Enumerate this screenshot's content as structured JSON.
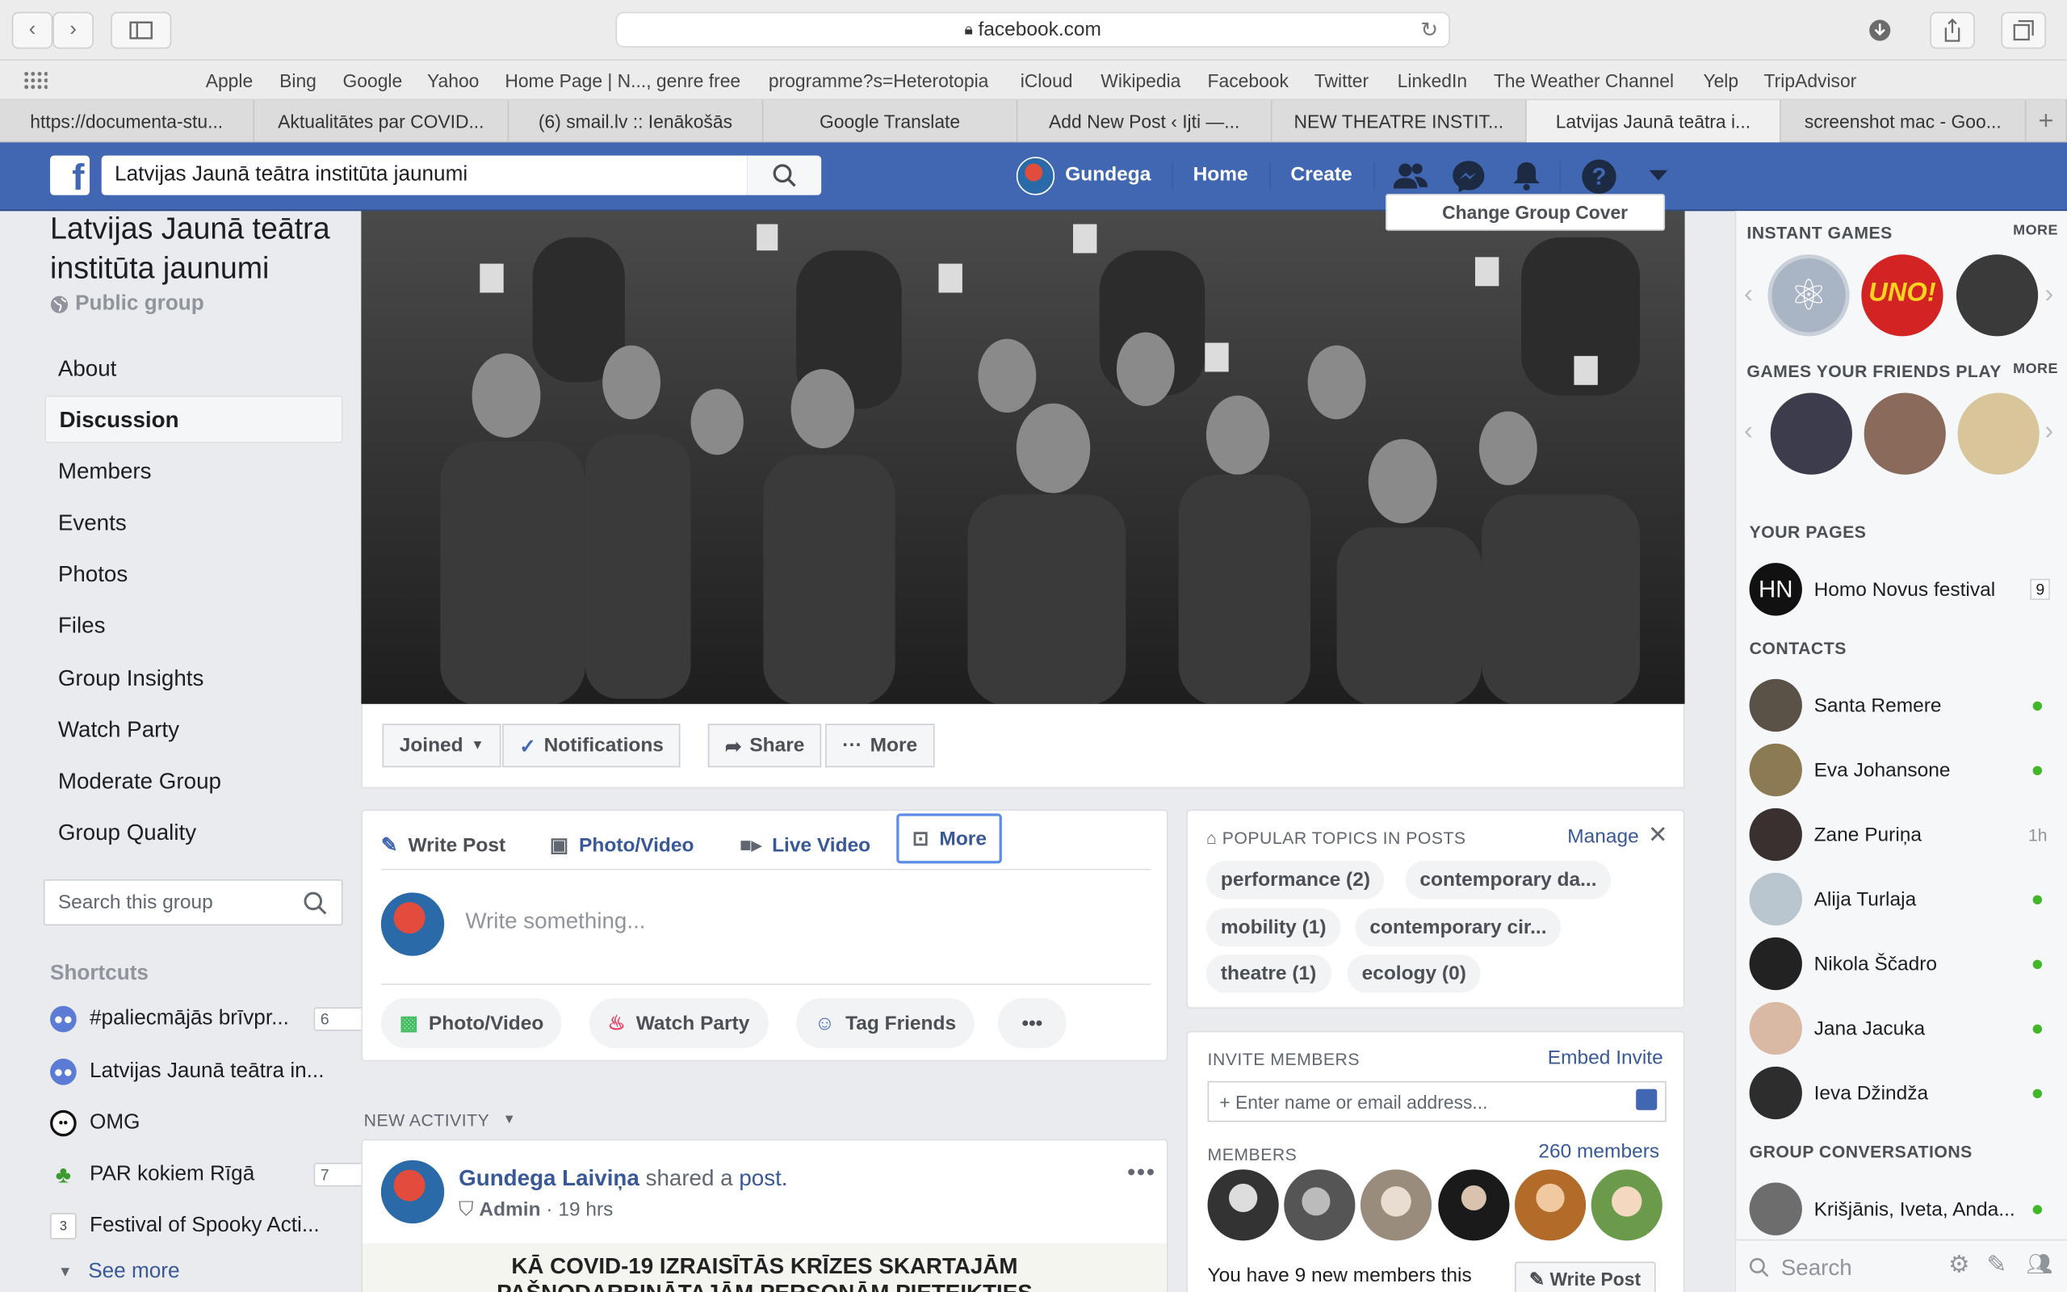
{
  "browser": {
    "url": "facebook.com",
    "favorites": [
      "Apple",
      "Bing",
      "Google",
      "Yahoo",
      "Home Page | N..., genre free",
      "programme?s=Heterotopia",
      "iCloud",
      "Wikipedia",
      "Facebook",
      "Twitter",
      "LinkedIn",
      "The Weather Channel",
      "Yelp",
      "TripAdvisor"
    ],
    "tabs": [
      "https://documenta-stu...",
      "Aktualitātes par COVID...",
      "(6) smail.lv :: Ienākošās",
      "Google Translate",
      "Add New Post ‹ Ijti —...",
      "NEW THEATRE INSTIT...",
      "Latvijas Jaunā teātra i...",
      "screenshot mac - Goo..."
    ]
  },
  "header": {
    "search_value": "Latvijas Jaunā teātra institūta jaunumi",
    "user": "Gundega",
    "home": "Home",
    "create": "Create"
  },
  "group": {
    "name": "Latvijas Jaunā teātra institūta jaunumi",
    "privacy": "Public group",
    "nav": [
      "About",
      "Discussion",
      "Members",
      "Events",
      "Photos",
      "Files",
      "Group Insights",
      "Watch Party",
      "Moderate Group",
      "Group Quality"
    ],
    "search_placeholder": "Search this group",
    "shortcuts_title": "Shortcuts",
    "shortcuts": [
      {
        "label": "#paliecmājās brīvpr...",
        "badge": "6"
      },
      {
        "label": "Latvijas Jaunā teātra in...",
        "badge": ""
      },
      {
        "label": "OMG",
        "badge": ""
      },
      {
        "label": "PAR kokiem Rīgā",
        "badge": "7"
      },
      {
        "label": "Festival of Spooky Acti...",
        "badge": ""
      }
    ],
    "see_more": "See more",
    "change_cover": "Change Group Cover"
  },
  "actions": {
    "joined": "Joined",
    "notifications": "Notifications",
    "share": "Share",
    "more": "More"
  },
  "composer": {
    "tabs": [
      "Write Post",
      "Photo/Video",
      "Live Video",
      "More"
    ],
    "placeholder": "Write something...",
    "pills": [
      "Photo/Video",
      "Watch Party",
      "Tag Friends"
    ]
  },
  "topics": {
    "title": "POPULAR TOPICS IN POSTS",
    "manage": "Manage",
    "items": [
      "performance (2)",
      "contemporary da...",
      "mobility (1)",
      "contemporary cir...",
      "theatre (1)",
      "ecology (0)"
    ]
  },
  "invite": {
    "title": "INVITE MEMBERS",
    "embed": "Embed Invite",
    "placeholder": "+ Enter name or email address...",
    "members_title": "MEMBERS",
    "members_count": "260 members",
    "new_members": "You have 9 new members this",
    "write_post": "Write Post"
  },
  "activity": {
    "title": "NEW ACTIVITY",
    "author": "Gundega Laiviņa",
    "shared": "shared a",
    "post": "post.",
    "role": "Admin",
    "time": "· 19 hrs",
    "preview_line1": "KĀ COVID-19 IZRAISĪTĀS KRĪZES SKARTAJĀM",
    "preview_line2": "PAŠNODARBINĀTAJĀM PERSONĀM PIETEIKTIES"
  },
  "sidebar": {
    "instant_games": "INSTANT GAMES",
    "more": "MORE",
    "friends_games": "GAMES YOUR FRIENDS PLAY",
    "your_pages": "YOUR PAGES",
    "page_name": "Homo Novus festival",
    "page_badge": "9",
    "contacts_title": "CONTACTS",
    "contacts": [
      {
        "name": "Santa Remere",
        "status": ""
      },
      {
        "name": "Eva Johansone",
        "status": ""
      },
      {
        "name": "Zane Puriņa",
        "status": "1h"
      },
      {
        "name": "Alija Turlaja",
        "status": ""
      },
      {
        "name": "Nikola Ščadro",
        "status": ""
      },
      {
        "name": "Jana Jacuka",
        "status": ""
      },
      {
        "name": "Ieva Džindža",
        "status": ""
      }
    ],
    "group_conv_title": "GROUP CONVERSATIONS",
    "group_conv": "Krišjānis, Iveta, Anda...",
    "search_placeholder": "Search"
  }
}
